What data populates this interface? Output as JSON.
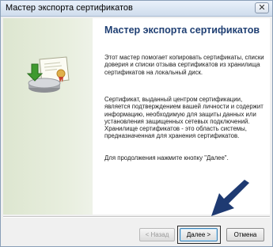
{
  "window": {
    "title": "Мастер экспорта сертификатов",
    "close_glyph": "✕"
  },
  "main": {
    "heading": "Мастер экспорта сертификатов",
    "paragraph1": "Этот мастер помогает копировать сертификаты, списки доверия и списки отзыва сертификатов из хранилища сертификатов на локальный диск.",
    "paragraph2": "Сертификат, выданный центром сертификации, является подтверждением вашей личности и содержит информацию, необходимую для защиты данных или установления защищенных сетевых подключений. Хранилище сертификатов - это область системы, предназначенная для хранения сертификатов.",
    "paragraph3": "Для продолжения нажмите кнопку \"Далее\"."
  },
  "buttons": {
    "back": "< Назад",
    "next": "Далее >",
    "cancel": "Отмена"
  },
  "icons": {
    "certificate_export": "certificate-export-icon",
    "pointer_arrow": "pointer-arrow-icon"
  },
  "colors": {
    "heading": "#1f3f73",
    "arrow": "#1e3a72",
    "side_panel": "#e8eede"
  }
}
